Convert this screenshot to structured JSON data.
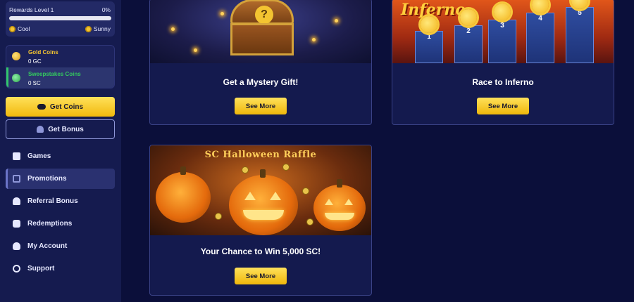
{
  "sidebar": {
    "rewards": {
      "level_label": "Rewards Level 1",
      "progress_label": "0%",
      "progress": 0,
      "tier_current": "Cool",
      "tier_next": "Sunny"
    },
    "wallet": [
      {
        "name": "Gold Coins",
        "value": "0 GC"
      },
      {
        "name": "Sweepstakes Coins",
        "value": "0 SC"
      }
    ],
    "get_coins_label": "Get Coins",
    "get_bonus_label": "Get Bonus",
    "nav": [
      {
        "label": "Games",
        "icon": "games-icon",
        "active": false
      },
      {
        "label": "Promotions",
        "icon": "promotions-icon",
        "active": true
      },
      {
        "label": "Referral Bonus",
        "icon": "referral-icon",
        "active": false
      },
      {
        "label": "Redemptions",
        "icon": "redemptions-icon",
        "active": false
      },
      {
        "label": "My Account",
        "icon": "account-icon",
        "active": false
      },
      {
        "label": "Support",
        "icon": "support-icon",
        "active": false
      }
    ]
  },
  "promotions": [
    {
      "title": "Get a Mystery Gift!",
      "button": "See More",
      "image": {
        "question_mark": "?"
      }
    },
    {
      "title": "Race to Inferno",
      "button": "See More",
      "image": {
        "logo": "Inferno",
        "podium_numbers": [
          "1",
          "2",
          "3",
          "4",
          "5"
        ]
      }
    },
    {
      "title": "Your Chance to Win 5,000 SC!",
      "button": "See More",
      "image": {
        "banner": "SC Halloween Raffle"
      }
    }
  ],
  "colors": {
    "accent": "#f3c431",
    "sweeps": "#34c95f",
    "bg": "#0b0f3a"
  }
}
